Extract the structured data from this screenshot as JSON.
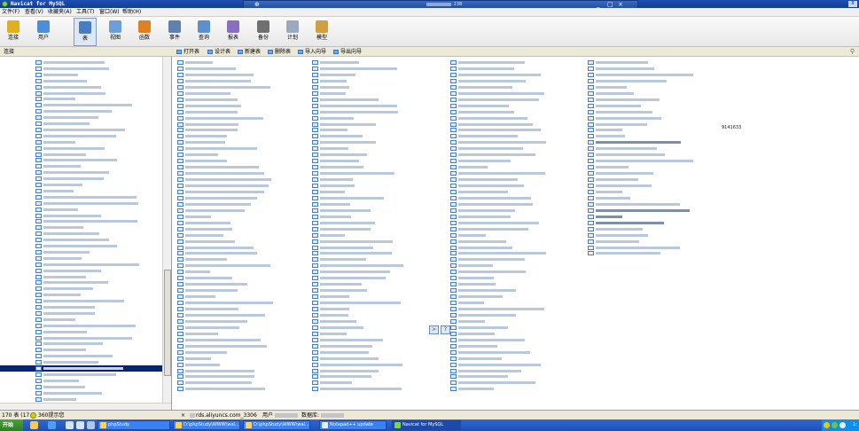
{
  "window": {
    "title": "Navicat for MySQL",
    "close_label": "X"
  },
  "remote": {
    "host_suffix": ".138",
    "controls": [
      "_",
      "□",
      "×"
    ]
  },
  "menu": [
    "文件(F)",
    "查看(V)",
    "收藏夹(A)",
    "工具(T)",
    "窗口(W)",
    "帮助(H)"
  ],
  "toolbar": [
    {
      "label": "连接",
      "icon": "plug-icon",
      "color": "#e0b020",
      "active": false
    },
    {
      "label": "用户",
      "icon": "user-icon",
      "color": "#4a8fd8",
      "active": false
    },
    {
      "label": "表",
      "icon": "table-icon",
      "color": "#4a7cc4",
      "active": true
    },
    {
      "label": "视图",
      "icon": "view-icon",
      "color": "#6a9fd8",
      "active": false
    },
    {
      "label": "函数",
      "icon": "function-icon",
      "color": "#e08020",
      "active": false
    },
    {
      "label": "事件",
      "icon": "event-clock-icon",
      "color": "#6080b0",
      "active": false
    },
    {
      "label": "查询",
      "icon": "query-icon",
      "color": "#5a90d0",
      "active": false
    },
    {
      "label": "报表",
      "icon": "report-icon",
      "color": "#8a6fc0",
      "active": false
    },
    {
      "label": "备份",
      "icon": "backup-icon",
      "color": "#707070",
      "active": false
    },
    {
      "label": "计划",
      "icon": "schedule-icon",
      "color": "#9aa8c0",
      "active": false
    },
    {
      "label": "模型",
      "icon": "model-icon",
      "color": "#d0a040",
      "active": false
    }
  ],
  "object_bar": {
    "connection_label": "连接",
    "buttons": [
      "打开表",
      "设计表",
      "新建表",
      "删除表",
      "导入向导",
      "导出向导"
    ]
  },
  "main": {
    "visible_name_fragment": "9141633"
  },
  "center_nav": [
    ">",
    "?"
  ],
  "status": {
    "table_count": "170 表 (17",
    "info": "360提示您",
    "connection": "rds.aliyuncs.com_3306",
    "user_label": "用户",
    "database_label": "数据库:"
  },
  "taskbar": {
    "start_label": "开始",
    "tasks": [
      {
        "label": "phpStudy",
        "active": false
      },
      {
        "label": "D:\\phpStudy\\WWW\\wal...",
        "active": false
      },
      {
        "label": "D:\\phpStudy\\WWW\\wal...",
        "active": false
      },
      {
        "label": "Notepad++ update",
        "active": false
      },
      {
        "label": "Navicat for MySQL",
        "active": true
      }
    ],
    "clock": "1:"
  },
  "colors": {
    "titlebar": "#1e4fb3",
    "selected_row": "#0a246a",
    "taskbar": "#3168d5",
    "start_button": "#49a23b"
  }
}
